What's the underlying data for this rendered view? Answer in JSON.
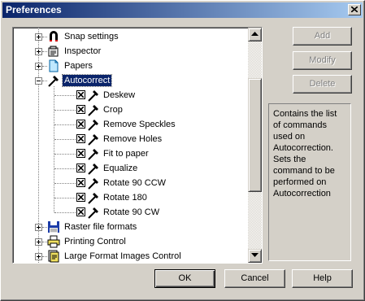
{
  "window": {
    "title": "Preferences"
  },
  "tree": {
    "items": [
      {
        "label": "Snap settings",
        "icon": "magnet-icon",
        "expander": "plus"
      },
      {
        "label": "Inspector",
        "icon": "inspector-icon",
        "expander": "plus"
      },
      {
        "label": "Papers",
        "icon": "paper-icon",
        "expander": "plus"
      },
      {
        "label": "Autocorrect",
        "icon": "wand-icon",
        "expander": "minus",
        "selected": true,
        "children": [
          {
            "label": "Deskew",
            "checked": true
          },
          {
            "label": "Crop",
            "checked": true
          },
          {
            "label": "Remove Speckles",
            "checked": true
          },
          {
            "label": "Remove Holes",
            "checked": true
          },
          {
            "label": "Fit to paper",
            "checked": true
          },
          {
            "label": "Equalize",
            "checked": true
          },
          {
            "label": "Rotate 90 CCW",
            "checked": true
          },
          {
            "label": "Rotate 180",
            "checked": true
          },
          {
            "label": "Rotate 90 CW",
            "checked": true
          }
        ]
      },
      {
        "label": "Raster file formats",
        "icon": "floppy-icon",
        "expander": "plus"
      },
      {
        "label": "Printing Control",
        "icon": "printer-icon",
        "expander": "plus"
      },
      {
        "label": "Large Format Images Control",
        "icon": "large-format-icon",
        "expander": "plus"
      }
    ]
  },
  "side_buttons": {
    "add": "Add",
    "modify": "Modify",
    "delete": "Delete"
  },
  "description": "Contains the list of commands used on Autocorrection. Sets the command to be performed on Autocorrection",
  "bottom_buttons": {
    "ok": "OK",
    "cancel": "Cancel",
    "help": "Help"
  },
  "colors": {
    "title_start": "#0a246a",
    "title_end": "#a6caf0",
    "face": "#d4d0c8",
    "selection": "#0a246a"
  }
}
